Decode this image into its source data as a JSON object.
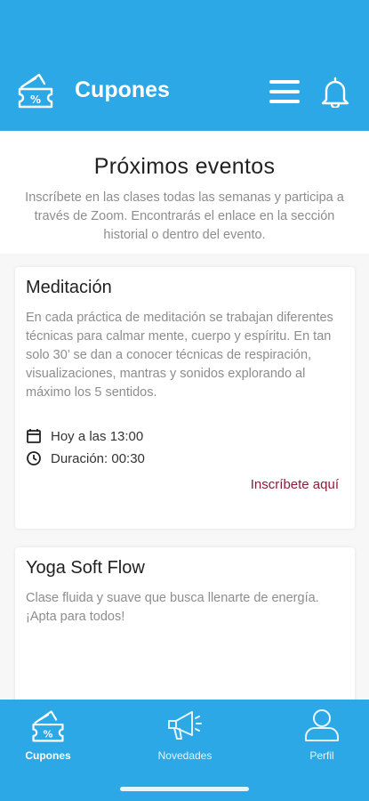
{
  "header": {
    "title": "Cupones",
    "logo_icon": "coupon-percent-icon",
    "menu_icon": "hamburger-menu-icon",
    "bell_icon": "bell-icon",
    "color": "#2da8e6"
  },
  "intro": {
    "title": "Próximos eventos",
    "description": "Inscríbete en las clases todas las semanas y participa a través de Zoom.  Encontrarás el enlace en la sección historial o dentro del evento."
  },
  "events": [
    {
      "title": "Meditación",
      "description": "En cada práctica de meditación se trabajan diferentes técnicas para calmar mente, cuerpo y espíritu. En tan solo 30’ se dan a conocer técnicas de respiración, visualizaciones, mantras y sonidos explorando al máximo los 5 sentidos.",
      "date": "Hoy a las 13:00",
      "duration": "Duración: 00:30",
      "cta": "Inscríbete aquí",
      "date_icon": "calendar-icon",
      "duration_icon": "clock-icon"
    },
    {
      "title": "Yoga Soft Flow",
      "description": "Clase fluida y suave que busca llenarte de energía. ¡Apta para todos!"
    }
  ],
  "tabs": [
    {
      "label": "Cupones",
      "icon": "coupon-percent-icon",
      "active": true
    },
    {
      "label": "Novedades",
      "icon": "megaphone-icon",
      "active": false
    },
    {
      "label": "Perfil",
      "icon": "user-profile-icon",
      "active": false
    }
  ],
  "accent_color": "#8b1d3a"
}
